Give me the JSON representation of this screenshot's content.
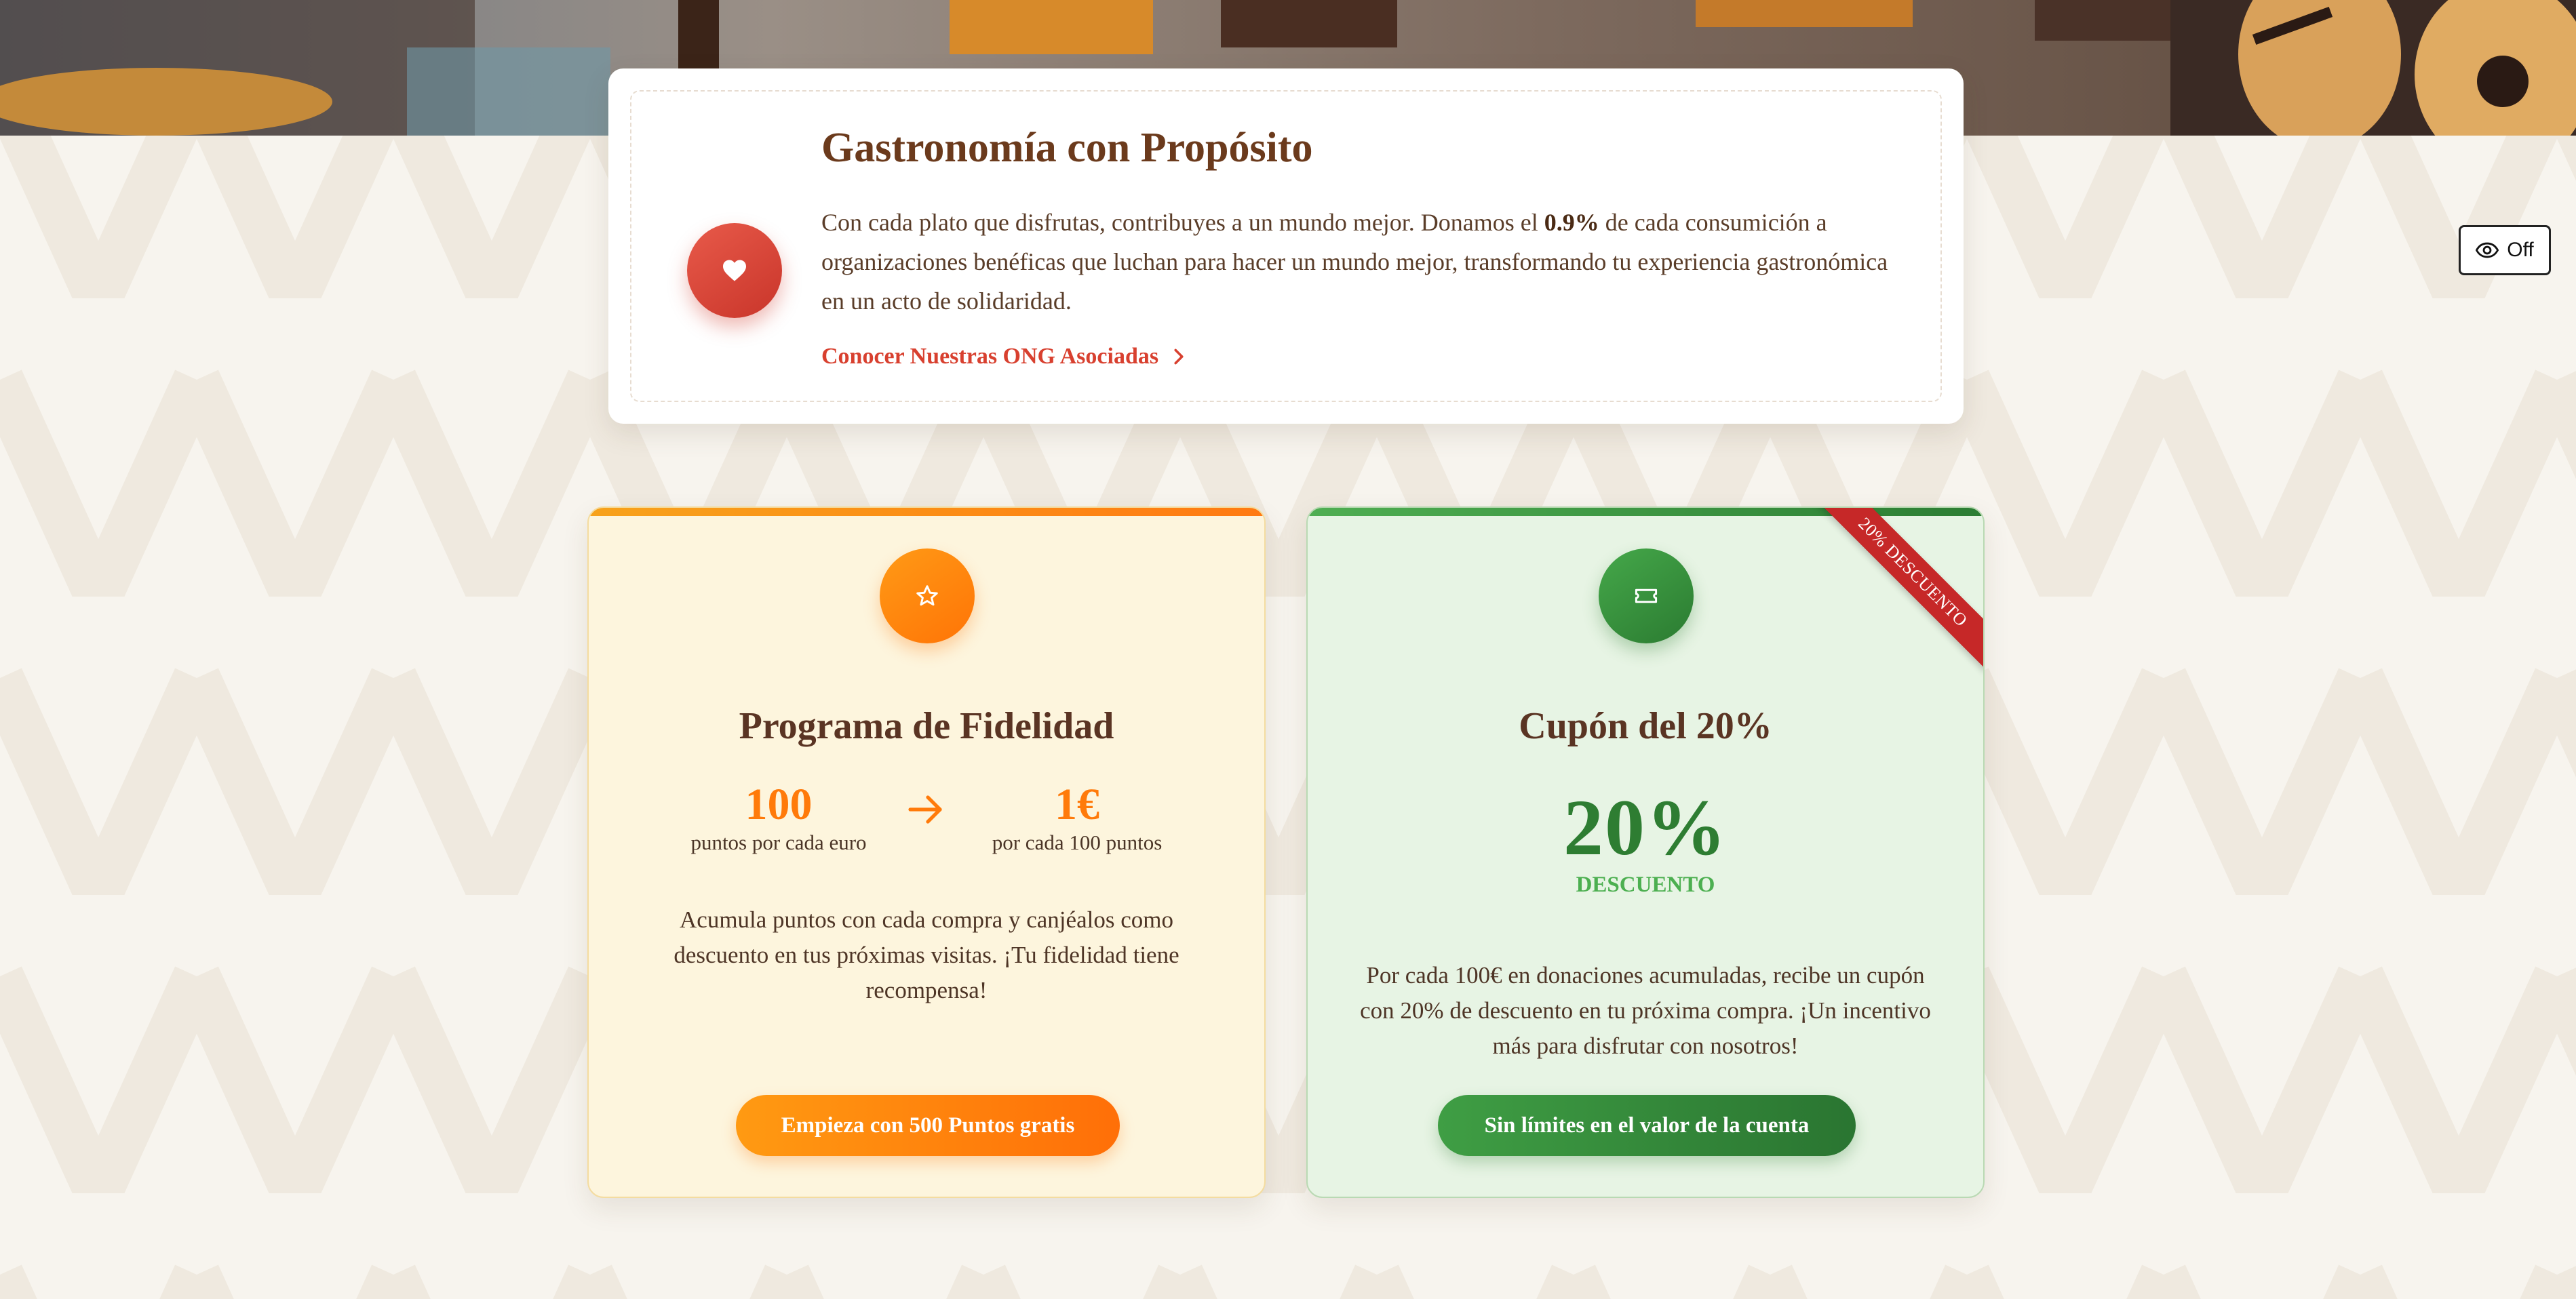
{
  "purpose": {
    "title": "Gastronomía con Propósito",
    "text_before": "Con cada plato que disfrutas, contribuyes a un mundo mejor. Donamos el ",
    "highlight": "0.9%",
    "text_after": " de cada consumición a organizaciones benéficas que luchan para hacer un mundo mejor, transformando tu experiencia gastronómica en un acto de solidaridad.",
    "link_label": "Conocer Nuestras ONG Asociadas",
    "icon": "heart-icon"
  },
  "eye_toggle": {
    "label": "Off",
    "icon": "eye-icon"
  },
  "loyalty": {
    "title": "Programa de Fidelidad",
    "icon": "star-icon",
    "stat_left_value": "100",
    "stat_left_label": "puntos por cada euro",
    "stat_right_value": "1€",
    "stat_right_label": "por cada 100 puntos",
    "description": "Acumula puntos con cada compra y canjéalos como descuento en tus próximas visitas. ¡Tu fidelidad tiene recompensa!",
    "button_label": "Empieza con 500 Puntos gratis"
  },
  "coupon": {
    "title": "Cupón del 20%",
    "icon": "ticket-icon",
    "ribbon": "20% DESCUENTO",
    "big_value": "20%",
    "big_label": "DESCUENTO",
    "description": "Por cada 100€ en donaciones acumuladas, recibe un cupón con 20% de descuento en tu próxima compra. ¡Un incentivo más para disfrutar con nosotros!",
    "button_label": "Sin límites en el valor de la cuenta"
  },
  "colors": {
    "accent_red": "#d8402f",
    "loyalty_orange": "#ff7a0a",
    "coupon_green": "#2e7d32",
    "title_brown": "#5a3423"
  }
}
